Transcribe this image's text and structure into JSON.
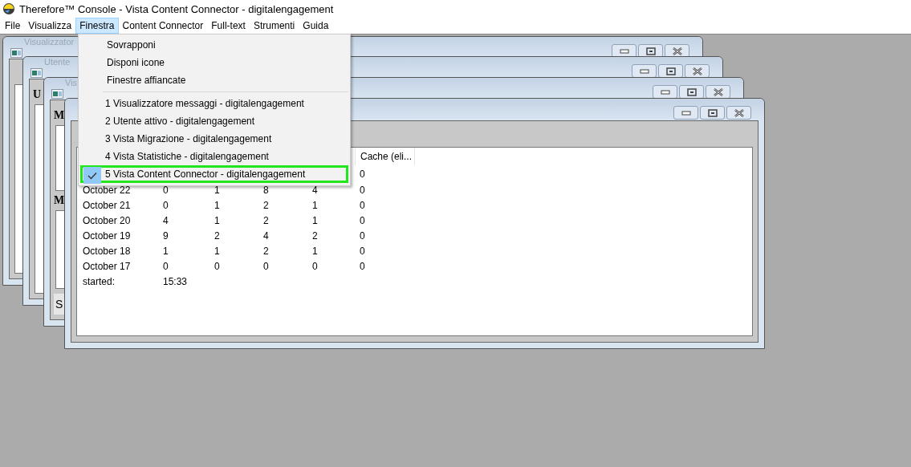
{
  "app_title": "Therefore™ Console - Vista Content Connector - digitalengagement",
  "menu": [
    {
      "label": "File",
      "selected": false
    },
    {
      "label": "Visualizza",
      "selected": false
    },
    {
      "label": "Finestra",
      "selected": true
    },
    {
      "label": "Content Connector",
      "selected": false
    },
    {
      "label": "Full-text",
      "selected": false
    },
    {
      "label": "Strumenti",
      "selected": false
    },
    {
      "label": "Guida",
      "selected": false
    }
  ],
  "windows": [
    {
      "title": "Visualizzator",
      "blocks": [
        {
          "kind": "heading_space"
        },
        {
          "kind": "list"
        }
      ]
    },
    {
      "title": "Utente",
      "blocks": [
        {
          "kind": "heading",
          "text": "U"
        },
        {
          "kind": "list"
        }
      ]
    },
    {
      "title": "Vis",
      "blocks": [
        {
          "kind": "heading",
          "text": "M"
        },
        {
          "kind": "list"
        },
        {
          "kind": "heading",
          "text": "M"
        },
        {
          "kind": "list"
        },
        {
          "kind": "footer",
          "text": "S"
        }
      ]
    }
  ],
  "active_window": {
    "table": {
      "column_6": "Cache (eli...",
      "top_row": {
        "column_6": "0"
      },
      "rows": [
        {
          "cells": [
            "October 22",
            "0",
            "1",
            "8",
            "4",
            "0"
          ]
        },
        {
          "cells": [
            "October 21",
            "0",
            "1",
            "2",
            "1",
            "0"
          ]
        },
        {
          "cells": [
            "October 20",
            "4",
            "1",
            "2",
            "1",
            "0"
          ]
        },
        {
          "cells": [
            "October 19",
            "9",
            "2",
            "4",
            "2",
            "0"
          ]
        },
        {
          "cells": [
            "October 18",
            "1",
            "1",
            "2",
            "1",
            "0"
          ]
        },
        {
          "cells": [
            "October 17",
            "0",
            "0",
            "0",
            "0",
            "0"
          ]
        },
        {
          "cells": [
            "started:",
            "15:33"
          ]
        }
      ]
    }
  },
  "dropdown": [
    {
      "kind": "command",
      "label": "Sovrapponi"
    },
    {
      "kind": "command",
      "label": "Disponi icone"
    },
    {
      "kind": "command",
      "label": "Finestre affiancate"
    },
    {
      "kind": "separator"
    },
    {
      "kind": "window",
      "label": "1 Visualizzatore messaggi - digitalengagement",
      "checked": false,
      "highlighted": false
    },
    {
      "kind": "window",
      "label": "2 Utente attivo - digitalengagement",
      "checked": false,
      "highlighted": false
    },
    {
      "kind": "window",
      "label": "3 Vista Migrazione - digitalengagement",
      "checked": false,
      "highlighted": false
    },
    {
      "kind": "window",
      "label": "4 Vista Statistiche - digitalengagement",
      "checked": false,
      "highlighted": false
    },
    {
      "kind": "window",
      "label": "5 Vista Content Connector - digitalengagement",
      "checked": true,
      "highlighted": true
    }
  ]
}
